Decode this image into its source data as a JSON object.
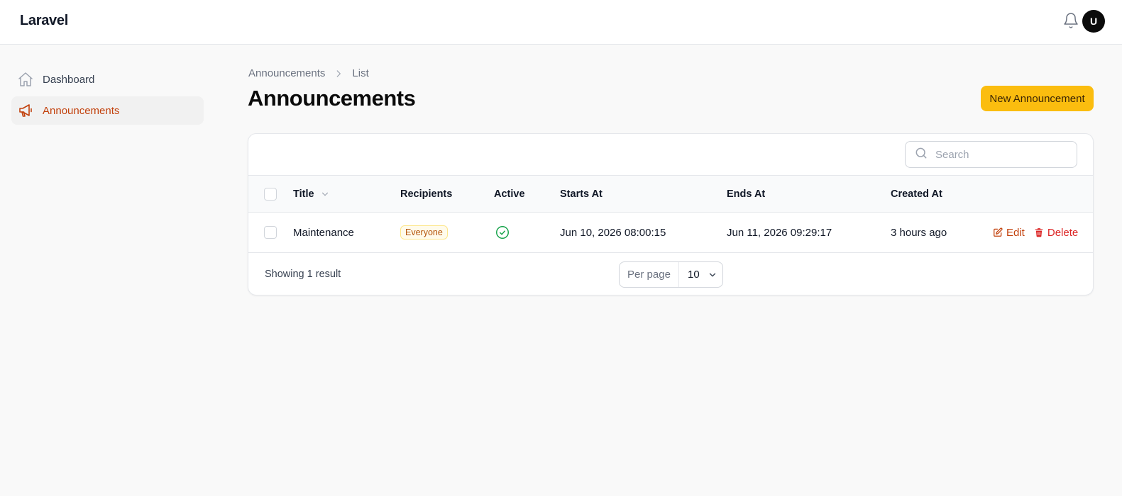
{
  "app": {
    "brand": "Laravel",
    "avatar_initial": "U"
  },
  "sidebar": {
    "items": [
      {
        "label": "Dashboard",
        "icon": "home-icon",
        "active": false
      },
      {
        "label": "Announcements",
        "icon": "megaphone-icon",
        "active": true
      }
    ]
  },
  "breadcrumb": {
    "parent": "Announcements",
    "current": "List"
  },
  "page": {
    "title": "Announcements",
    "primary_action": "New Announcement"
  },
  "search": {
    "placeholder": "Search",
    "value": ""
  },
  "table": {
    "columns": {
      "title": "Title",
      "recipients": "Recipients",
      "active": "Active",
      "starts_at": "Starts At",
      "ends_at": "Ends At",
      "created_at": "Created At"
    },
    "rows": [
      {
        "title": "Maintenance",
        "recipients": "Everyone",
        "active": true,
        "starts_at": "Jun 10, 2026 08:00:15",
        "ends_at": "Jun 11, 2026 09:29:17",
        "created_at": "3 hours ago",
        "edit_label": "Edit",
        "delete_label": "Delete"
      }
    ]
  },
  "footer": {
    "showing": "Showing 1 result",
    "per_page_label": "Per page",
    "per_page_value": "10"
  },
  "colors": {
    "accent": "#c2410c",
    "primary_button": "#fbbd0f",
    "danger": "#dc2626",
    "success": "#16a34a",
    "badge_text": "#b45309"
  }
}
